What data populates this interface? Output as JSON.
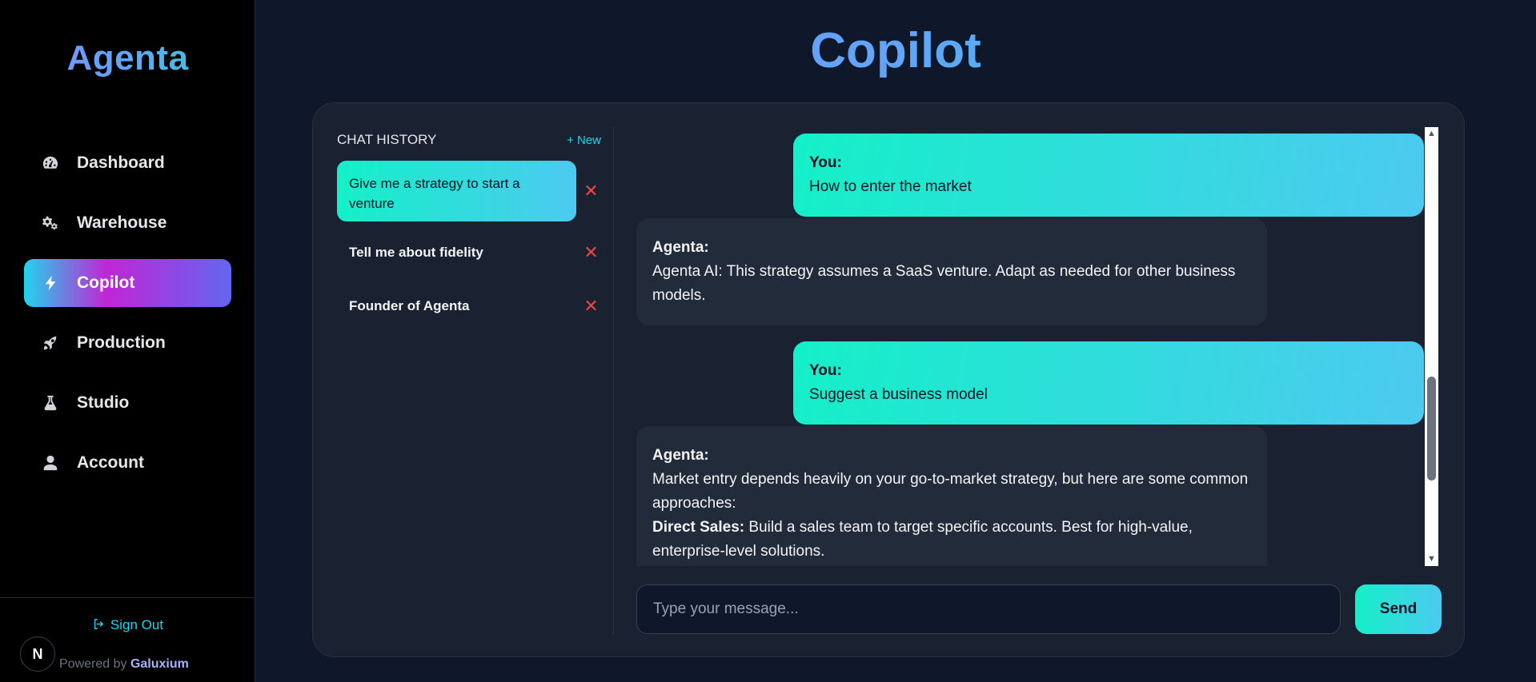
{
  "app": {
    "brand": "Agenta",
    "page_title": "Copilot"
  },
  "sidebar": {
    "items": [
      {
        "label": "Dashboard",
        "icon": "gauge-icon"
      },
      {
        "label": "Warehouse",
        "icon": "gears-icon"
      },
      {
        "label": "Copilot",
        "icon": "bolt-icon",
        "active": true
      },
      {
        "label": "Production",
        "icon": "rocket-icon"
      },
      {
        "label": "Studio",
        "icon": "flask-icon"
      },
      {
        "label": "Account",
        "icon": "user-icon"
      }
    ],
    "sign_out": "Sign Out",
    "powered_prefix": "Powered by",
    "powered_brand": "Galuxium",
    "badge": "N"
  },
  "history": {
    "title": "CHAT HISTORY",
    "new_label": "+ New",
    "items": [
      {
        "label": "Give me a strategy to start a venture",
        "active": true
      },
      {
        "label": "Tell me about fidelity"
      },
      {
        "label": "Founder of Agenta"
      }
    ],
    "delete_glyph": "✕"
  },
  "messages": [
    {
      "role": "user",
      "who": "You:",
      "text": "How to enter the market"
    },
    {
      "role": "bot",
      "who": "Agenta:",
      "text": "Agenta AI: This strategy assumes a SaaS venture. Adapt as needed for other business models."
    },
    {
      "role": "user",
      "who": "You:",
      "text": "Suggest a business model"
    },
    {
      "role": "bot",
      "who": "Agenta:",
      "text": "Market entry depends heavily on your go-to-market strategy, but here are some common approaches:",
      "bold_lead": "Direct Sales:",
      "extra": " Build a sales team to target specific accounts. Best for high-value, enterprise-level solutions."
    }
  ],
  "composer": {
    "placeholder": "Type your message...",
    "send_label": "Send"
  },
  "colors": {
    "accent": "#22d3ee",
    "user_bubble_start": "#14f0c8",
    "user_bubble_end": "#4cc9f0",
    "danger": "#ef4444"
  }
}
